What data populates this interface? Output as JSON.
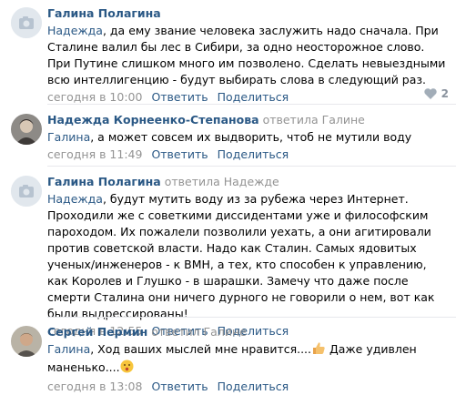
{
  "comments": [
    {
      "author": "Галина Полагина",
      "replied": "",
      "avatar": "camera-icon",
      "mention": "Надежда",
      "text": ", да ему звание человека заслужить надо сначала. При Сталине валил бы лес в Сибири, за одно неосторожное слово. При Путине слишком много им позволено. Сделать невыездными всю интеллигенцию - будут выбирать слова в следующий раз.",
      "time": "сегодня в 10:00",
      "reply_label": "Ответить",
      "share_label": "Поделиться",
      "likes": "2"
    },
    {
      "author": "Надежда Корнеенко-Степанова",
      "replied": "ответила Галине",
      "avatar": "photo",
      "mention": "Галина",
      "text": ", а может совсем их выдворить, чтоб не мутили воду",
      "time": "сегодня в 11:49",
      "reply_label": "Ответить",
      "share_label": "Поделиться"
    },
    {
      "author": "Галина Полагина",
      "replied": "ответила Надежде",
      "avatar": "camera-icon",
      "mention": "Надежда",
      "text": ", будут мутить воду из за рубежа через Интернет. Проходили же с советкими диссидентами уже и философским пароходом. Их пожалели позволили уехать, а они агитировали против советской власти. Надо как Сталин. Самых ядовитых ученых/инженеров - к ВМН, а тех, кто способен к управлению, как Королев и Глушко - в шарашки. Замечу что даже после смерти Сталина они ничего дурного не говорили о нем, вот как были выдрессированы!",
      "time": "сегодня в 12:55",
      "reply_label": "Ответить",
      "share_label": "Поделиться"
    },
    {
      "author": "Сергей Пермин",
      "replied": "ответил Галине",
      "avatar": "photo",
      "mention": "Галина",
      "text": ", Ход ваших мыслей мне нравится....",
      "text2": " Даже удивлен маненько....",
      "time": "сегодня в 13:08",
      "reply_label": "Ответить",
      "share_label": "Поделиться"
    }
  ],
  "colors": {
    "link": "#2a5885",
    "meta": "#939393",
    "divider": "#e7e8ec"
  }
}
